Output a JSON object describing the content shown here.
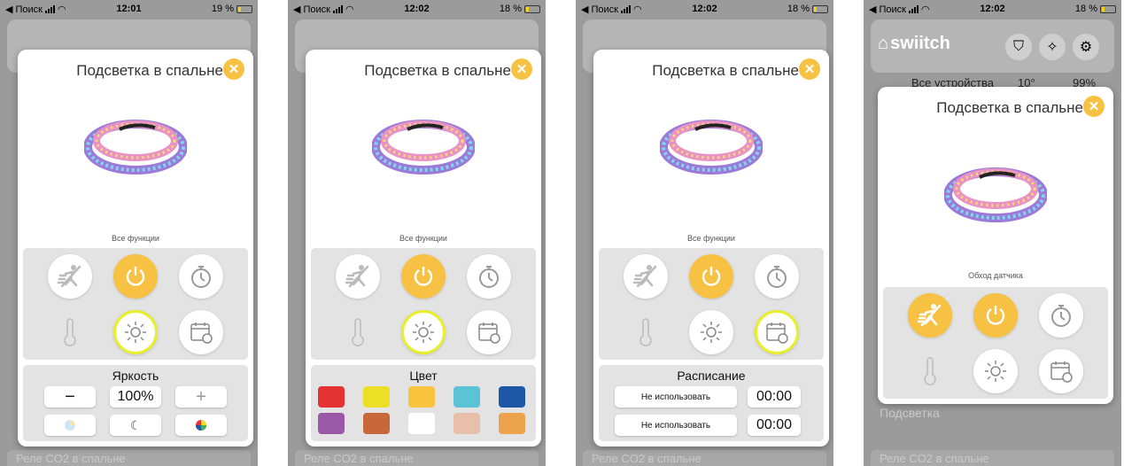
{
  "status_bar": {
    "search_label": "◀ Поиск",
    "screens": [
      {
        "time": "12:01",
        "battery": "19 %"
      },
      {
        "time": "12:02",
        "battery": "18 %"
      },
      {
        "time": "12:02",
        "battery": "18 %"
      },
      {
        "time": "12:02",
        "battery": "18 %"
      }
    ]
  },
  "modal": {
    "title": "Подсветка в спальне",
    "close_icon": "close-icon"
  },
  "screens": [
    {
      "caption": "Все функции",
      "panel_title": "Яркость"
    },
    {
      "caption": "Все функции",
      "panel_title": "Цвет"
    },
    {
      "caption": "Все функции",
      "panel_title": "Расписание"
    },
    {
      "caption": "Обход датчика"
    }
  ],
  "brightness": {
    "minus": "−",
    "value": "100%",
    "plus": "+"
  },
  "colors": [
    "#e43232",
    "#ece027",
    "#f9c43d",
    "#5ac4d6",
    "#1d58a6",
    "#9a58a6",
    "#c7673a",
    "#ffffff",
    "#e8bfa8",
    "#eda24c"
  ],
  "schedule": {
    "rows": [
      {
        "mode": "Не использовать",
        "time": "00:00"
      },
      {
        "mode": "Не использовать",
        "time": "00:00"
      }
    ]
  },
  "app": {
    "logo": "swiitch",
    "all_devices": "Все устройства",
    "temp": "10°",
    "humidity": "99%",
    "list_item": "Подсветка",
    "bottom_item": "Реле CO2 в спальне"
  },
  "accent": "#f7c244"
}
